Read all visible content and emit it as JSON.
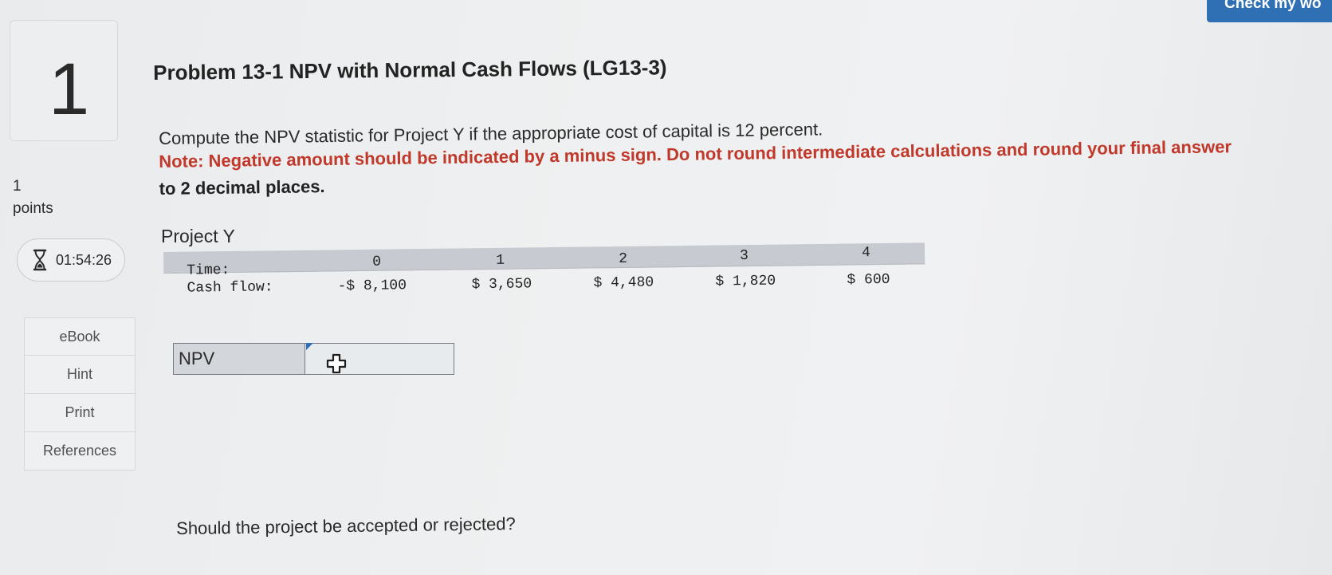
{
  "header": {
    "check_button_label": "Check my wo"
  },
  "question": {
    "number": "1",
    "points_value": "1",
    "points_label": "points",
    "timer": "01:54:26",
    "title": "Problem 13-1 NPV with Normal Cash Flows (LG13-3)",
    "prompt": "Compute the NPV statistic for Project Y if the appropriate cost of capital is 12 percent.",
    "note_line1": "Note: Negative amount should be indicated by a minus sign. Do not round intermediate calculations and round your final answer",
    "note_line2": "to 2 decimal places.",
    "project_label": "Project Y",
    "followup": "Should the project be accepted or rejected?"
  },
  "sidebar": {
    "items": [
      {
        "label": "eBook"
      },
      {
        "label": "Hint"
      },
      {
        "label": "Print"
      },
      {
        "label": "References"
      }
    ]
  },
  "cash_flow_table": {
    "time_label": "Time:",
    "cash_flow_label": "Cash flow:",
    "periods": [
      "0",
      "1",
      "2",
      "3",
      "4"
    ],
    "cash_flows": [
      "-$ 8,100",
      "$ 3,650",
      "$ 4,480",
      "$ 1,820",
      "$ 600"
    ]
  },
  "npv_input": {
    "label": "NPV",
    "value": ""
  },
  "icons": [
    "hourglass-icon",
    "move-cursor-icon"
  ]
}
